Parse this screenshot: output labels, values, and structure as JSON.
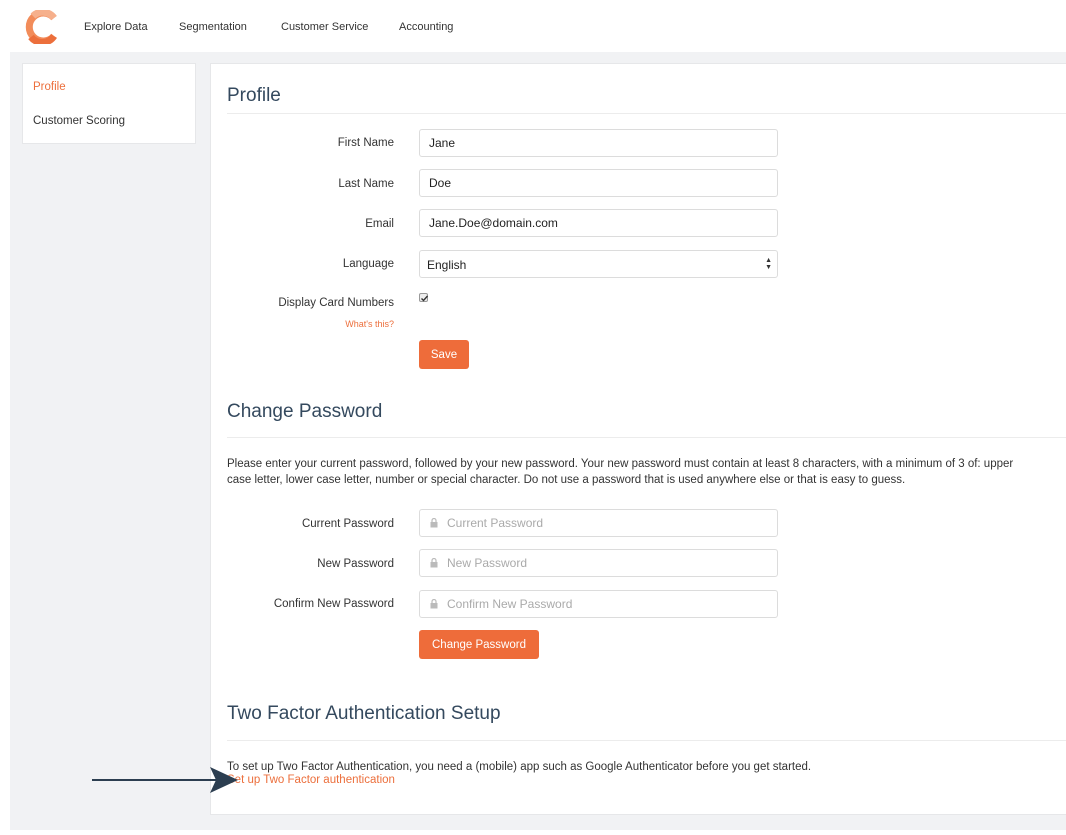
{
  "nav": {
    "items": [
      {
        "label": "Explore Data"
      },
      {
        "label": "Segmentation"
      },
      {
        "label": "Customer Service"
      },
      {
        "label": "Accounting"
      }
    ]
  },
  "sidebar": {
    "items": [
      {
        "label": "Profile",
        "active": true
      },
      {
        "label": "Customer Scoring",
        "active": false
      }
    ]
  },
  "profile": {
    "title": "Profile",
    "first_name_label": "First Name",
    "first_name_value": "Jane",
    "last_name_label": "Last Name",
    "last_name_value": "Doe",
    "email_label": "Email",
    "email_value": "Jane.Doe@domain.com",
    "language_label": "Language",
    "language_value": "English",
    "display_card_label": "Display Card Numbers",
    "display_card_checked": true,
    "whats_this": "What's this?",
    "save_label": "Save"
  },
  "password": {
    "title": "Change Password",
    "description_line1": "Please enter your current password, followed by your new password. Your new password must contain at least 8 characters, with a minimum of 3 of: upper",
    "description_line2": "case letter, lower case letter, number or special character. Do not use a password that is used anywhere else or that is easy to guess.",
    "current_label": "Current Password",
    "current_placeholder": "Current Password",
    "new_label": "New Password",
    "new_placeholder": "New Password",
    "confirm_label": "Confirm New Password",
    "confirm_placeholder": "Confirm New Password",
    "button_label": "Change Password"
  },
  "two_factor": {
    "title": "Two Factor Authentication Setup",
    "description": "To set up Two Factor Authentication, you need a (mobile) app such as Google Authenticator before you get started.",
    "link_label": "Set up Two Factor authentication"
  },
  "colors": {
    "accent": "#ec6f3c",
    "heading": "#34495e",
    "background": "#f1f2f4"
  }
}
